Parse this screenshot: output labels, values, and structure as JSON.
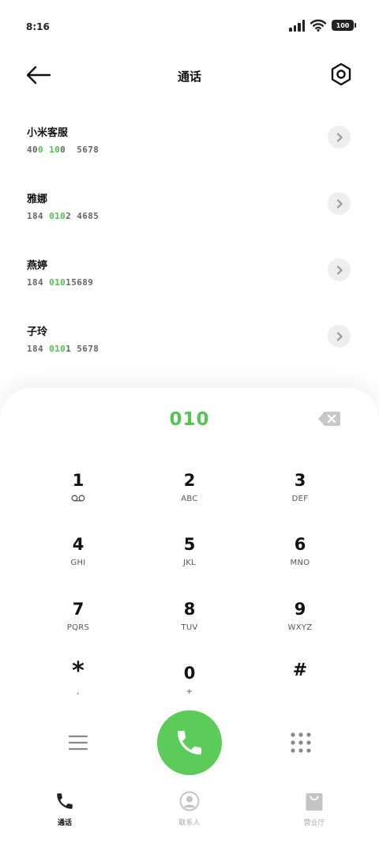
{
  "status_bar": {
    "time": "8:16",
    "battery": "100"
  },
  "header": {
    "title": "通话"
  },
  "contacts": [
    {
      "name": "小米客服",
      "number_parts": [
        {
          "text": "40"
        },
        {
          "text": "0",
          "hl": true
        },
        {
          "text": " "
        },
        {
          "text": "10",
          "hl": true
        },
        {
          "text": "0  5678"
        }
      ]
    },
    {
      "name": "雅娜",
      "number_parts": [
        {
          "text": "184 "
        },
        {
          "text": "010",
          "hl": true
        },
        {
          "text": "2 4685"
        }
      ]
    },
    {
      "name": "燕婷",
      "number_parts": [
        {
          "text": "184 "
        },
        {
          "text": "010",
          "hl": true
        },
        {
          "text": "15689"
        }
      ]
    },
    {
      "name": "子玲",
      "number_parts": [
        {
          "text": "184 "
        },
        {
          "text": "010",
          "hl": true
        },
        {
          "text": "1 5678"
        }
      ]
    }
  ],
  "dialer": {
    "input": "010",
    "keys": [
      {
        "digit": "1",
        "letters": "",
        "icon": "voicemail-icon"
      },
      {
        "digit": "2",
        "letters": "ABC"
      },
      {
        "digit": "3",
        "letters": "DEF"
      },
      {
        "digit": "4",
        "letters": "GHI"
      },
      {
        "digit": "5",
        "letters": "JKL"
      },
      {
        "digit": "6",
        "letters": "MNO"
      },
      {
        "digit": "7",
        "letters": "PQRS"
      },
      {
        "digit": "8",
        "letters": "TUV"
      },
      {
        "digit": "9",
        "letters": "WXYZ"
      },
      {
        "digit": "*",
        "letters": ","
      },
      {
        "digit": "0",
        "letters": "+"
      },
      {
        "digit": "#",
        "letters": ""
      }
    ]
  },
  "tabs": [
    {
      "label": "通话",
      "icon": "phone-icon",
      "active": true
    },
    {
      "label": "联系人",
      "icon": "person-icon",
      "active": false
    },
    {
      "label": "营业厅",
      "icon": "shopping-bag-icon",
      "active": false
    }
  ],
  "colors": {
    "accent": "#5ccc59",
    "highlight": "#4fc24c",
    "chevron_bg": "#eeeeee"
  }
}
